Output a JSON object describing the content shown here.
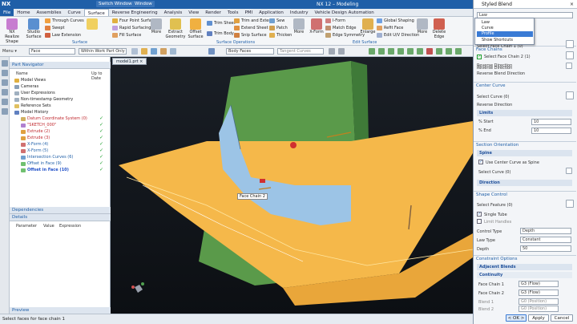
{
  "app": {
    "logo": "NX",
    "title": "NX 12 – Modeling",
    "switch_window": "Switch Window",
    "window": "Window"
  },
  "menu": [
    "File",
    "Home",
    "Assemblies",
    "Curve",
    "Surface",
    "Reverse Engineering",
    "Analysis",
    "View",
    "Render",
    "Tools",
    "PMI",
    "Application",
    "Industry",
    "Vehicle Design Automation"
  ],
  "ribbon": {
    "big": [
      "NX Realize Shape",
      "Studio Surface",
      "More",
      "Extract Geometry",
      "Offset Surface",
      "More",
      "X-Form",
      "Enlarge",
      "More",
      "Delete Edge"
    ],
    "small": [
      "Through Curves",
      "Swept",
      "Law Extension",
      "Four Point Surface",
      "Rapid Surfacing",
      "Fill Surface",
      "Trim Sheet",
      "Trim Body",
      "Trim and Extend",
      "Extend Sheet",
      "Snip Surface",
      "Sew",
      "Patch",
      "Thicken",
      "I-Form",
      "Match Edge",
      "Edge Symmetry",
      "Global Shaping",
      "Refit Face",
      "Edit U/V Direction"
    ],
    "groups": [
      "Surface",
      "Surface Operations",
      "Edit Surface"
    ]
  },
  "selbar": {
    "menu": "Menu ▾",
    "filter": "Face",
    "scope": "Within Work Part Only",
    "rule": "Body Faces",
    "curve_rule": "Tangent Curves"
  },
  "nav": {
    "title": "Part Navigator",
    "col_name": "Name",
    "col_up": "Up to Date",
    "items": [
      {
        "label": "Model Views",
        "style": ""
      },
      {
        "label": "Cameras",
        "style": ""
      },
      {
        "label": "User Expressions",
        "style": ""
      },
      {
        "label": "Non-timestamp Geometry",
        "style": ""
      },
      {
        "label": "Reference Sets",
        "style": ""
      },
      {
        "label": "Model History",
        "style": ""
      },
      {
        "label": "Datum Coordinate System (0)",
        "style": "red"
      },
      {
        "label": "\"SKETCH_000\"",
        "style": "red"
      },
      {
        "label": "Extrude (2)",
        "style": "red"
      },
      {
        "label": "Extrude (3)",
        "style": "red"
      },
      {
        "label": "X-Form (4)",
        "style": "blue"
      },
      {
        "label": "X-Form (5)",
        "style": "blue"
      },
      {
        "label": "Intersection Curves (6)",
        "style": "blue"
      },
      {
        "label": "Offset in Face (9)",
        "style": "blue"
      },
      {
        "label": "Offset in Face (10)",
        "style": "hl"
      }
    ],
    "dependencies": "Dependencies",
    "details": "Details",
    "detail_cols": [
      "Parameter",
      "Value",
      "Expression"
    ],
    "preview": "Preview"
  },
  "viewport": {
    "tab": "model1.prt ×",
    "label": "Face Chain 2"
  },
  "status": "Select faces for face chain 1",
  "dialog": {
    "title": "Styled Blend",
    "type_value": "Law",
    "options": [
      "Law",
      "Curve",
      "Profile",
      "Show Shortcuts"
    ],
    "face_chains": "Face Chains",
    "select_face_chain_1": "Select Face Chain 1 (0)",
    "reverse_direction": "Reverse Direction",
    "select_face_chain_2": "Select Face Chain 2 (1)",
    "reverse_direction_2": "Reverse Direction",
    "reverse_blend_direction": "Reverse Blend Direction",
    "center_curve": "Center Curve",
    "select_curve": "Select Curve (0)",
    "reverse_direction_3": "Reverse Direction",
    "limits": "Limits",
    "pct_start": "% Start",
    "pct_start_val": "10",
    "pct_end": "% End",
    "pct_end_val": "10",
    "section_orientation": "Section Orientation",
    "spine": "Spine",
    "use_center_curve": "Use Center Curve as Spine",
    "select_curve_2": "Select Curve (0)",
    "direction": "Direction",
    "shape_control": "Shape Control",
    "select_feature": "Select Feature (0)",
    "single_tube": "Single Tube",
    "limit_handles": "Limit Handles",
    "control_type": "Control Type",
    "control_type_val": "Depth",
    "law_type": "Law Type",
    "law_type_val": "Constant",
    "depth": "Depth",
    "depth_val": "50",
    "constraint_options": "Constraint Options",
    "adjacent_blends": "Adjacent Blends",
    "continuity": "Continuity",
    "face_chain_1": "Face Chain 1",
    "face_chain_1_val": "G3 (Flow)",
    "face_chain_2": "Face Chain 2",
    "face_chain_2_val": "G3 (Flow)",
    "blend_1": "Blend 1",
    "blend_1_val": "G0 (Position)",
    "blend_2": "Blend 2",
    "blend_2_val": "G0 (Position)",
    "ok": "< OK >",
    "apply": "Apply",
    "cancel": "Cancel"
  },
  "colors": {
    "accent": "#1f5fa8",
    "surface_yellow": "#f5b84a",
    "surface_green": "#5a9a4a",
    "blend_blue": "#9cc4e6"
  }
}
